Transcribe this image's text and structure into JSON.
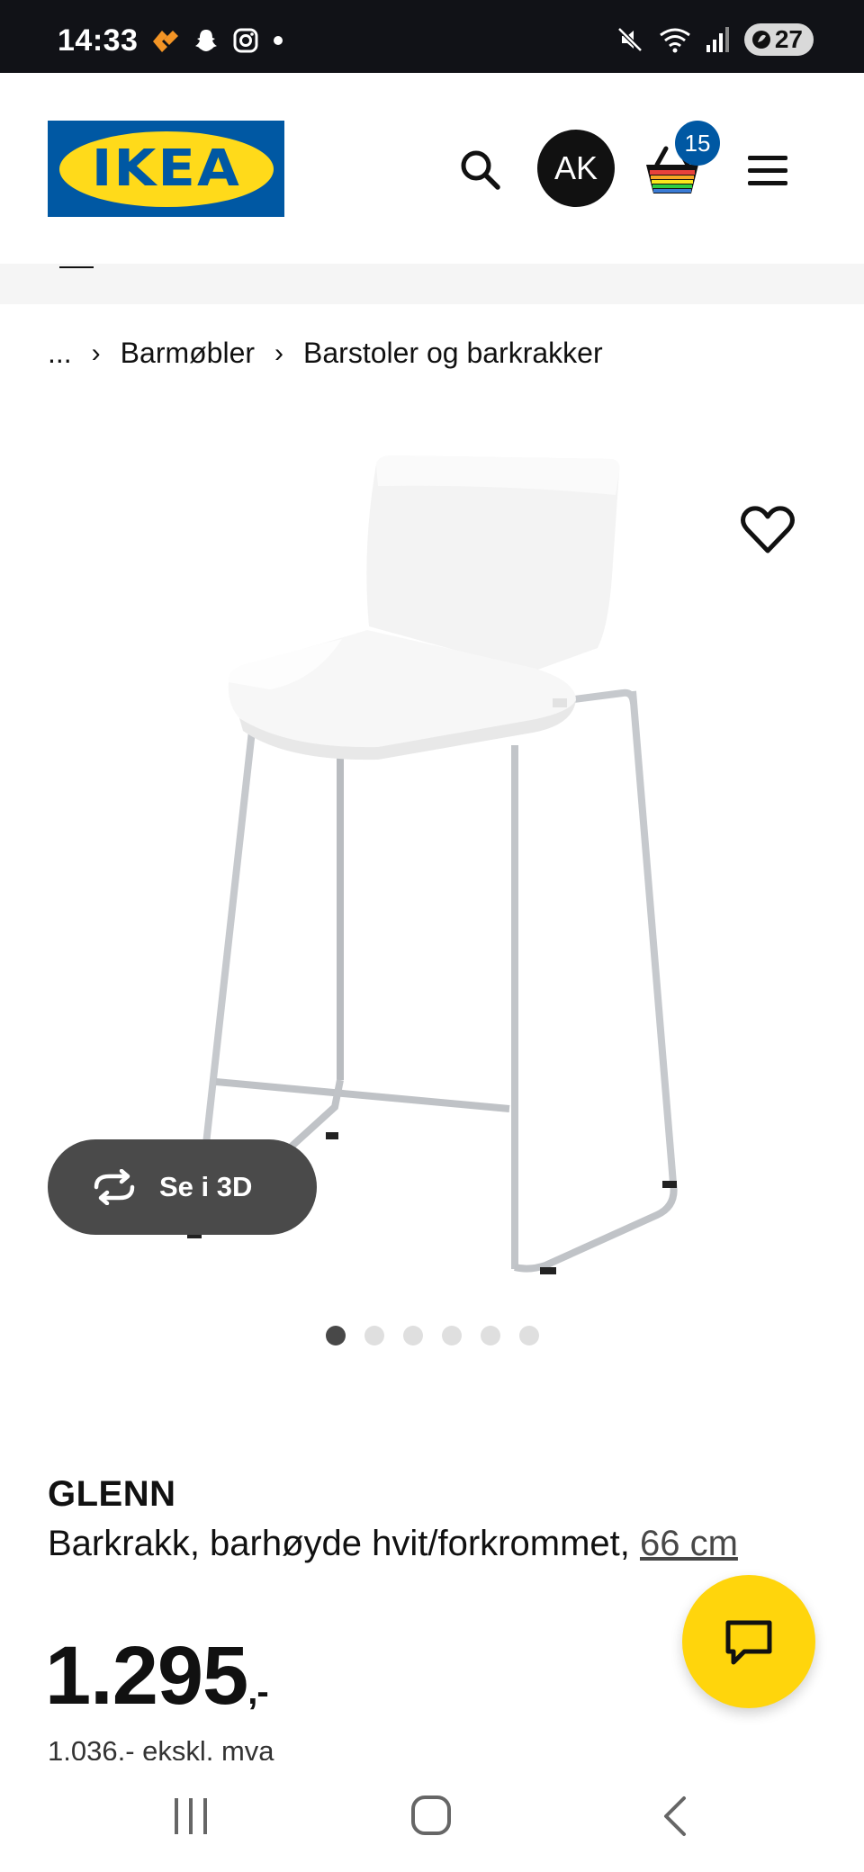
{
  "status_bar": {
    "time": "14:33",
    "battery": "27",
    "left_icons": [
      "health-icon",
      "snapchat-icon",
      "instagram-icon",
      "dot-icon"
    ],
    "right_icons": [
      "mute-icon",
      "wifi-icon",
      "signal-icon",
      "battery-icon"
    ]
  },
  "header": {
    "logo_text": "IKEA",
    "avatar_initials": "AK",
    "cart_count": "15",
    "brand_blue": "#0058a3",
    "brand_yellow": "#ffda1a"
  },
  "breadcrumb": {
    "ellipsis": "...",
    "items": [
      "Barmøbler",
      "Barstoler og barkrakker"
    ]
  },
  "product": {
    "see_3d_label": "Se i 3D",
    "carousel": {
      "count": 6,
      "active_index": 0
    },
    "name": "GLENN",
    "description": "Barkrakk, barhøyde hvit/forkrommet,",
    "size": "66 cm",
    "price": "1.295",
    "price_suffix": ",-",
    "price_ex_vat": "1.036,- ekskl. mva"
  },
  "chat_fab_color": "#ffd50c"
}
